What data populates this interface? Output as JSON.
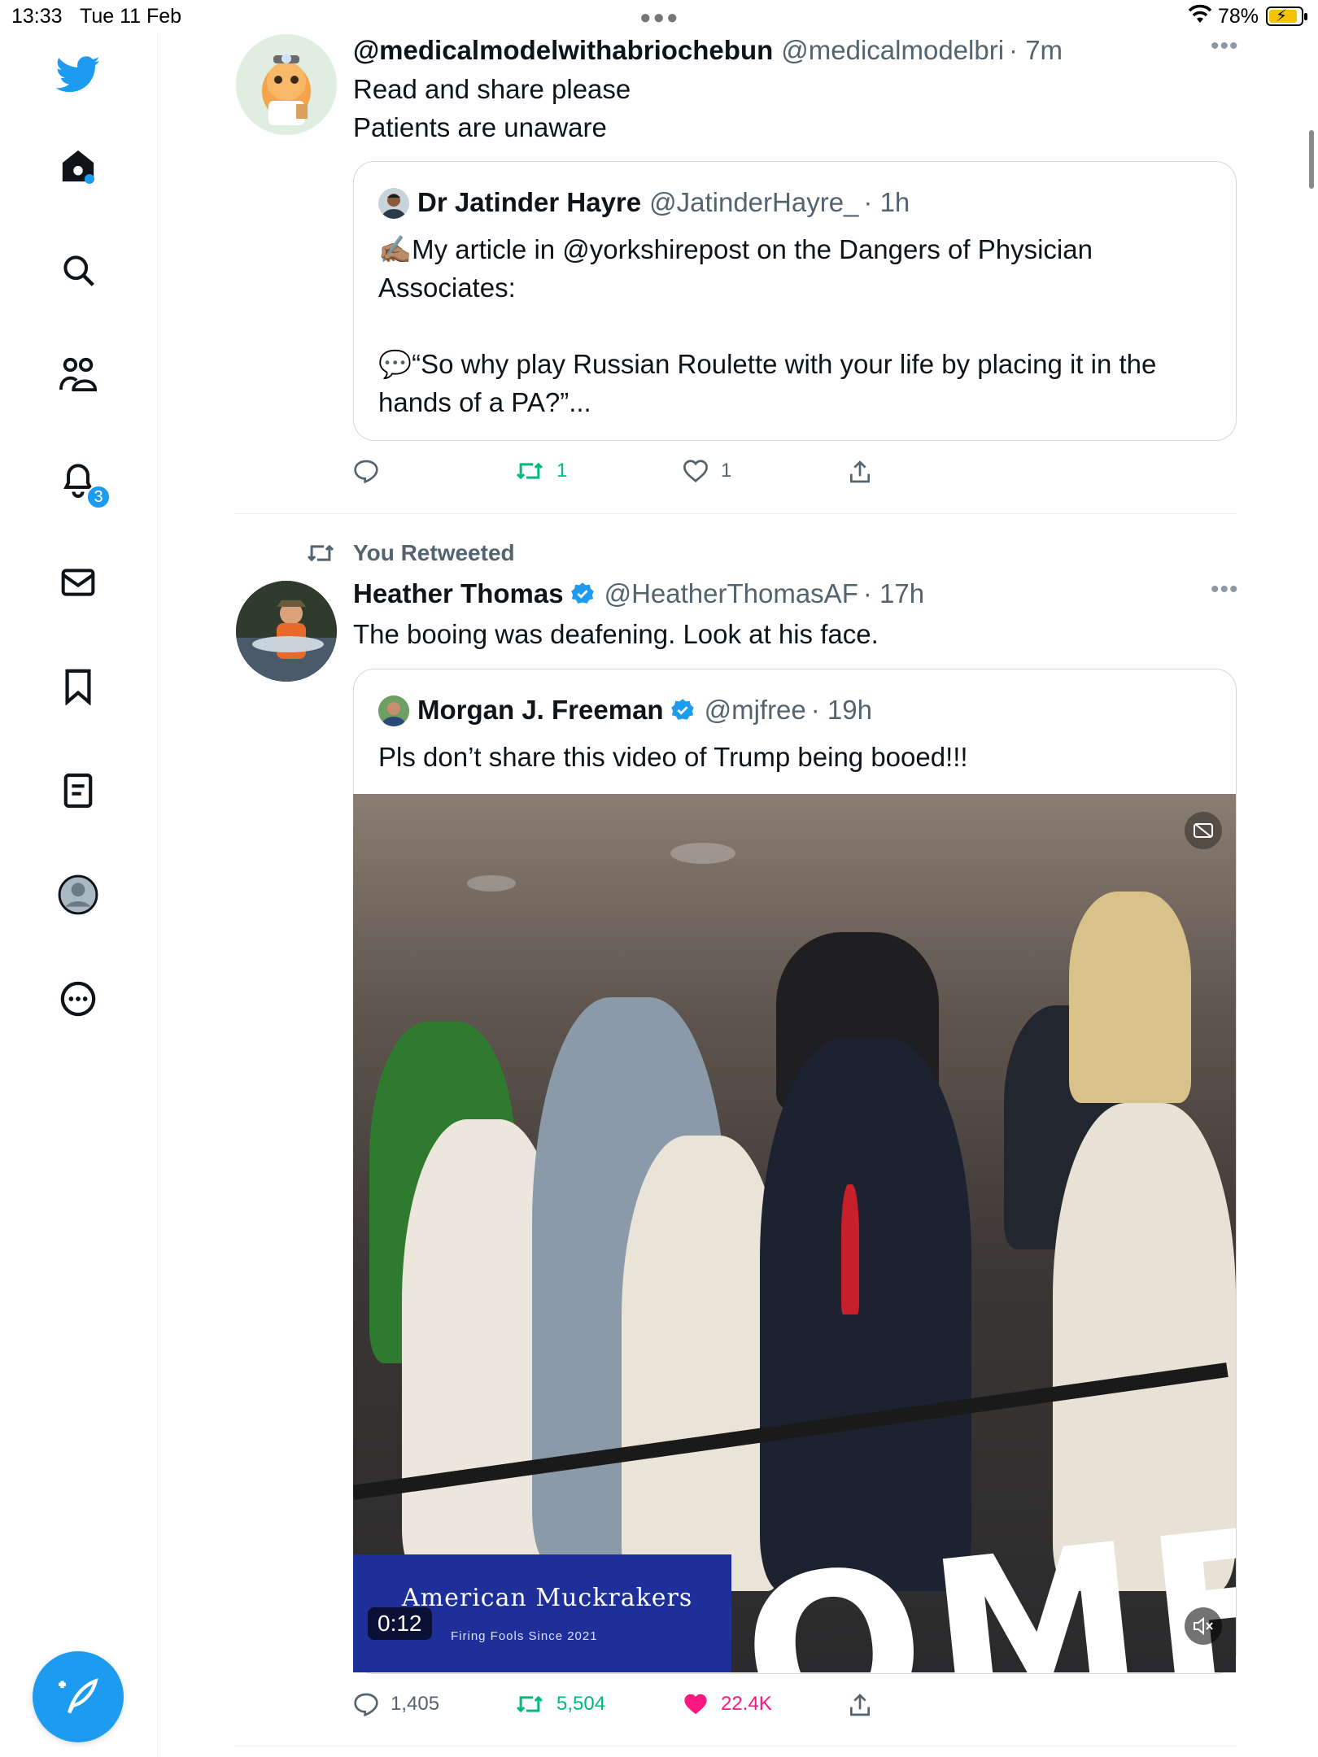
{
  "status_bar": {
    "time": "13:33",
    "date": "Tue 11 Feb",
    "battery": "78%"
  },
  "sidebar": {
    "items": [
      "twitter-logo",
      "home",
      "search",
      "communities",
      "notifications",
      "messages",
      "bookmarks",
      "lists",
      "profile",
      "more"
    ],
    "notifications_badge": "3"
  },
  "tweets": [
    {
      "display_name": "@medicalmodelwithabriochebun",
      "handle": "@medicalmodelbri",
      "time": "· 7m",
      "text_line1": "Read and share please",
      "text_line2": "Patients are unaware",
      "quote": {
        "display_name": "Dr Jatinder Hayre",
        "handle": "@JatinderHayre_",
        "time": "· 1h",
        "line1": "✍🏽My article in @yorkshirepost on the Dangers of Physician",
        "line2": "Associates:",
        "line3": "💬“So why play Russian Roulette with your life by placing it in the",
        "line4": "hands of a PA?”..."
      },
      "actions": {
        "replies": "",
        "retweets": "1",
        "likes": "1"
      }
    },
    {
      "social_context": "You Retweeted",
      "display_name": "Heather Thomas",
      "handle": "@HeatherThomasAF",
      "time": "· 17h",
      "text": "The booing was deafening. Look at his face.",
      "quote": {
        "display_name": "Morgan J. Freeman",
        "handle": "@mjfree",
        "time": "· 19h",
        "text": "Pls don’t share this video of Trump being booed!!!",
        "video": {
          "banner_title": "American Muckrakers",
          "banner_subtitle": "Firing Fools Since 2021",
          "duration": "0:12"
        }
      },
      "actions": {
        "replies": "1,405",
        "retweets": "5,504",
        "likes": "22.4K"
      }
    }
  ],
  "colors": {
    "accent": "#1d9bf0",
    "retweet": "#00ba7c",
    "like": "#f91880",
    "muted": "#536471"
  }
}
